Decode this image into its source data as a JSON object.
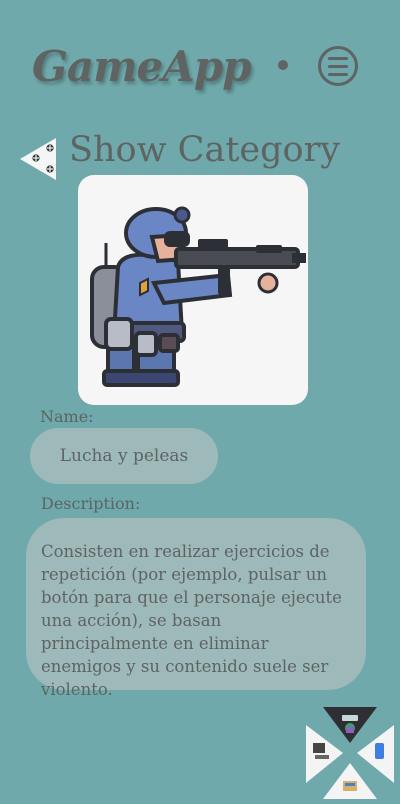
{
  "app": {
    "title": "GameApp"
  },
  "header": {
    "menu_icon": "hamburger-icon"
  },
  "page": {
    "back_icon": "back-arrow-icon",
    "title": "Show Category"
  },
  "category": {
    "image_icon": "soldier-illustration",
    "name_label": "Name:",
    "name": "Lucha y peleas",
    "description_label": "Description:",
    "description": "Consisten en realizar ejercicios de repetición (por ejemplo, pulsar un botón para que el personaje ejecute una acción), se basan principalmente en eliminar enemigos y su contenido  suele ser violento."
  },
  "corner_nav": {
    "icons": [
      "games-icon",
      "computer-icon",
      "mobile-icon",
      "console-icon"
    ]
  }
}
